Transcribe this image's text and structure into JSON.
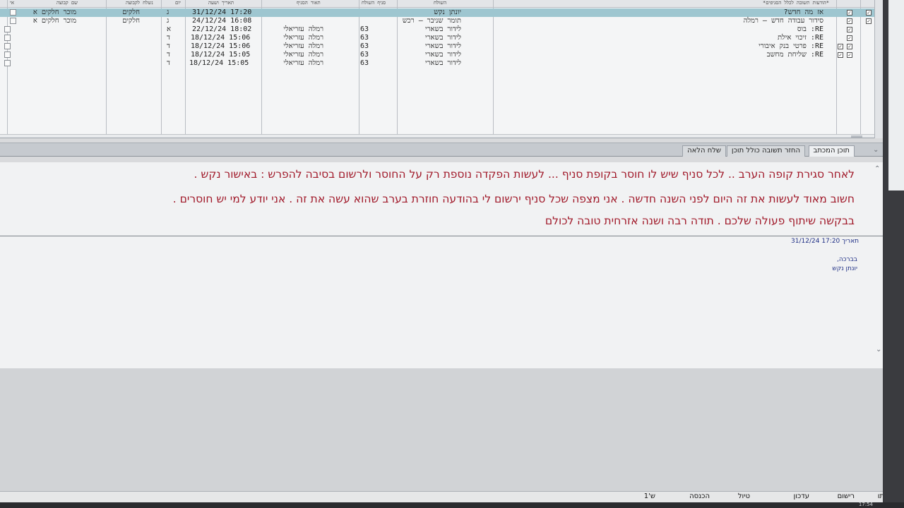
{
  "grid": {
    "headers": {
      "checkbox": "*",
      "subject": "*הודעות תשובה לכלל הסניפים*",
      "sender": "השולח",
      "sender_branch": "סניף השולח",
      "branch_desc": "תאור הסניף",
      "datetime": "תאריך ושעה",
      "day": "יום",
      "group": "נשלח לקבוצה",
      "group_name": "שם קבוצה",
      "flag": "אי"
    },
    "rows": [
      {
        "subject": "אז מה חדש?",
        "sender": "יונתן נקש",
        "branch": "",
        "branch_desc": "",
        "datetime": "31/12/24 17:20",
        "day": "ג",
        "group": "חלקים",
        "group_name": "מוכר חלקים א"
      },
      {
        "subject": "סידור עבודה חדש – רמלה",
        "sender": "תומר שניבר – רכש",
        "branch": "",
        "branch_desc": "",
        "datetime": "24/12/24 16:08",
        "day": "ג",
        "group": "חלקים",
        "group_name": "מוכר חלקים א"
      },
      {
        "subject": "RE: בוס",
        "sender": "לידור בשארי",
        "branch": "63",
        "branch_desc": "רמלה עזריאלי",
        "datetime": "22/12/24 18:02",
        "day": "א",
        "group": "",
        "group_name": ""
      },
      {
        "subject": "RE: זיכוי אילת",
        "sender": "לידור בשארי",
        "branch": "63",
        "branch_desc": "רמלה עזריאלי",
        "datetime": "18/12/24 15:06",
        "day": "ד",
        "group": "",
        "group_name": ""
      },
      {
        "subject": "RE: פרטי בנק איבורי",
        "sender": "לידור בשארי",
        "branch": "63",
        "branch_desc": "רמלה עזריאלי",
        "datetime": "18/12/24 15:06",
        "day": "ד",
        "group": "",
        "group_name": ""
      },
      {
        "subject": "RE: שליחת מחשב",
        "sender": "לידור בשארי",
        "branch": "63",
        "branch_desc": "רמלה עזריאלי",
        "datetime": "18/12/24 15:05",
        "day": "ד",
        "group": "",
        "group_name": ""
      },
      {
        "subject": "",
        "sender": "לידור בשארי",
        "branch": "63",
        "branch_desc": "רמלה עזריאלי",
        "datetime": "18/12/24 15:05",
        "day": "ד",
        "group": "",
        "group_name": ""
      }
    ]
  },
  "tabs": [
    "תוכן המכתב",
    "החזר תשובה כולל תוכן",
    "שלח הלאה"
  ],
  "message": {
    "lines": [
      "לאחר סגירת קופה הערב .. לכל סניף שיש לו חוסר בקופת סניף ... לעשות הפקדה נוספת רק על החוסר ולרשום בסיבה להפרש : באישור נקש .",
      "חשוב מאוד לעשות את זה היום לפני השנה חדשה . אני מצפה שכל סניף ירשום לי בהודעה חוזרת בערב שהוא עשה את זה . אני יודע למי יש חוסרים .",
      "בבקשה שיתוף פעולה שלכם . תודה רבה ושנה אזרחית טובה לכולם"
    ],
    "date_label": "תאריך",
    "date_value": "31/12/24 17:20",
    "greeting": "בברכה,",
    "signature": "יונתן נקש"
  },
  "toolbar": [
    "תו",
    "רישום",
    "עדכון",
    "טיול",
    "הכנסה",
    "ש'1"
  ],
  "clock": "17:54",
  "colors": {
    "message_text": "#a11a2a",
    "selected_row": "#9ec6d0",
    "meta_text": "#1f2f85"
  }
}
